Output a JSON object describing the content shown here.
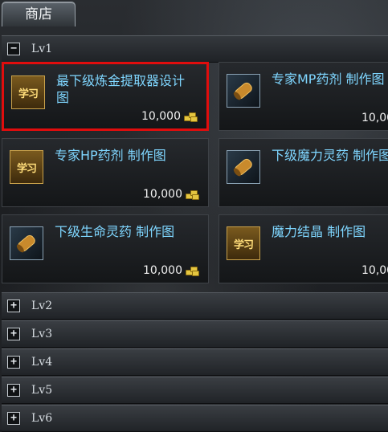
{
  "tab": {
    "label": "商店"
  },
  "levels": [
    {
      "label": "Lv1",
      "toggle": "−",
      "expanded": true
    },
    {
      "label": "Lv2",
      "toggle": "+"
    },
    {
      "label": "Lv3",
      "toggle": "+"
    },
    {
      "label": "Lv4",
      "toggle": "+"
    },
    {
      "label": "Lv5",
      "toggle": "+"
    },
    {
      "label": "Lv6",
      "toggle": "+"
    }
  ],
  "items": [
    {
      "icon": "learn-icon",
      "icon_text": "学习",
      "title": "最下级炼金提取器设计图",
      "price": "10,000",
      "selected": true
    },
    {
      "icon": "scroll-icon",
      "icon_text": "",
      "title": "专家MP药剂 制作图",
      "price": "10,000"
    },
    {
      "icon": "learn-icon",
      "icon_text": "学习",
      "title": "专家HP药剂 制作图",
      "price": "10,000"
    },
    {
      "icon": "scroll-icon",
      "icon_text": "",
      "title": "下级魔力灵药 制作图",
      "price": "10,000"
    },
    {
      "icon": "scroll-icon",
      "icon_text": "",
      "title": "下级生命灵药 制作图",
      "price": "10,000"
    },
    {
      "icon": "learn-icon",
      "icon_text": "学习",
      "title": "魔力结晶 制作图",
      "price": "10,000"
    }
  ],
  "colors": {
    "selection": "#e00d0d",
    "title": "#7fd6ff",
    "gold": "#e5c640"
  }
}
